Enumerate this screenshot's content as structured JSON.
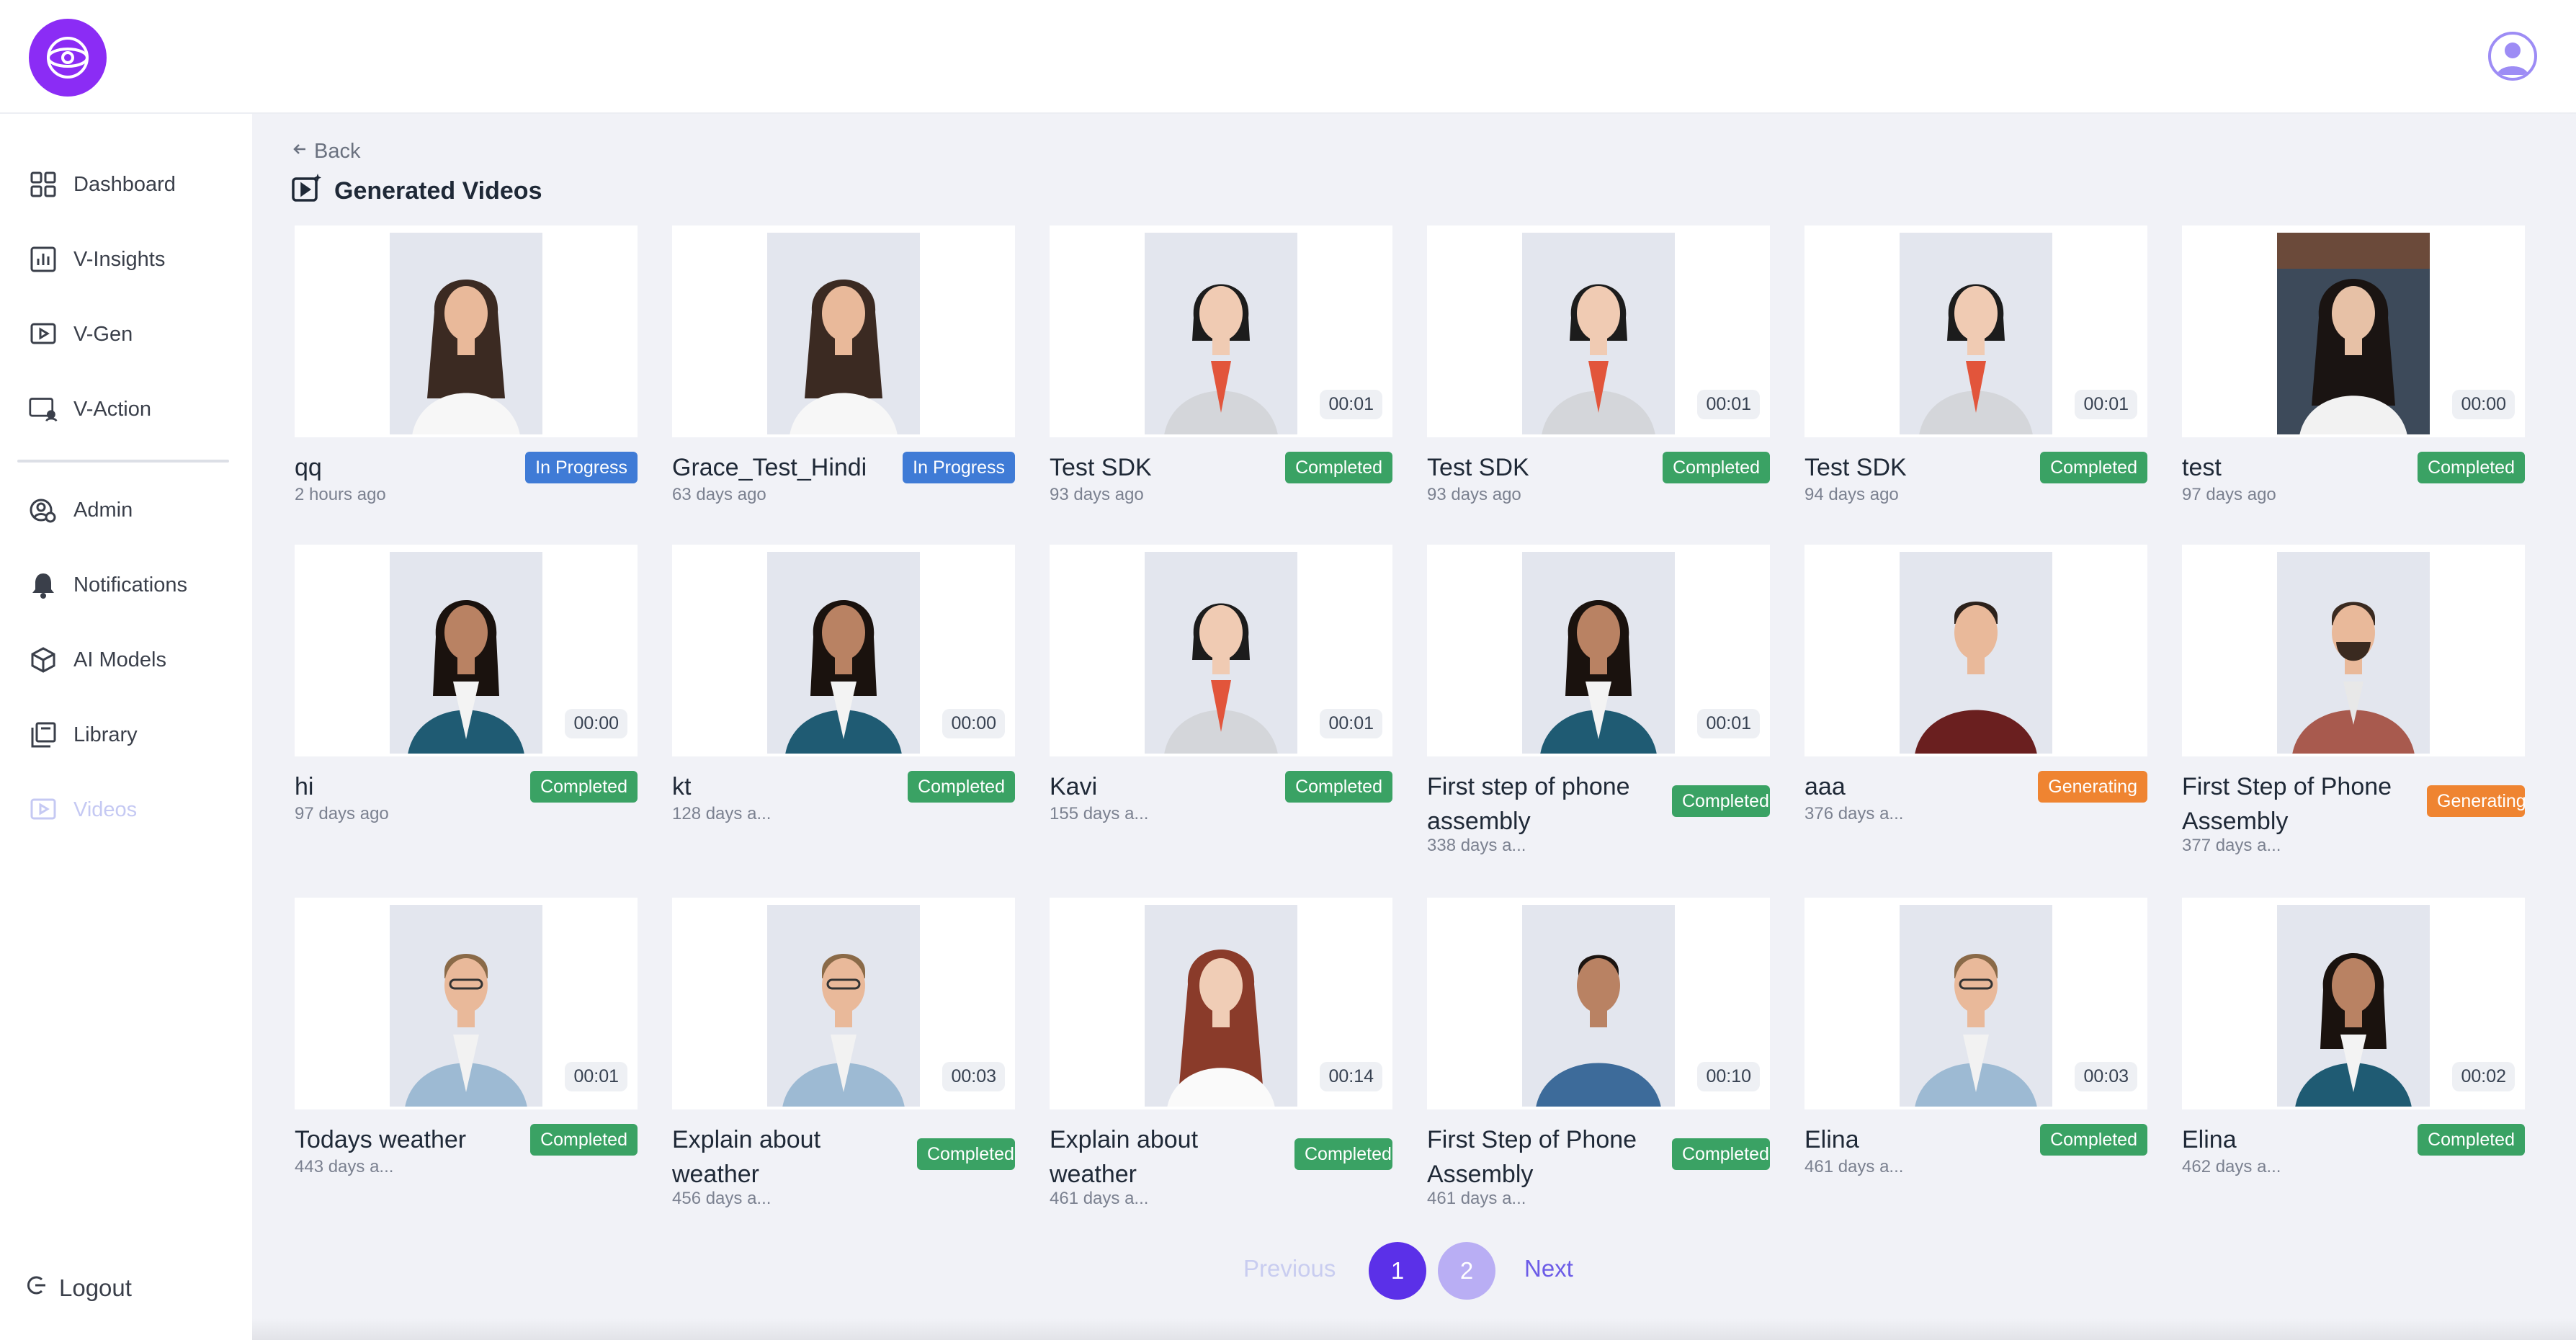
{
  "header": {
    "logo_icon": "globe-eye-logo",
    "profile_icon": "user-avatar-icon",
    "accent": "#8b2cf5"
  },
  "sidebar": {
    "items": [
      {
        "label": "Dashboard",
        "icon": "grid-icon"
      },
      {
        "label": "V-Insights",
        "icon": "bar-chart-icon"
      },
      {
        "label": "V-Gen",
        "icon": "play-square-icon"
      },
      {
        "label": "V-Action",
        "icon": "monitor-user-icon"
      },
      {
        "label": "Admin",
        "icon": "user-gear-icon"
      },
      {
        "label": "Notifications",
        "icon": "bell-icon"
      },
      {
        "label": "AI Models",
        "icon": "cube-icon"
      },
      {
        "label": "Library",
        "icon": "library-icon"
      },
      {
        "label": "Videos",
        "icon": "video-icon"
      }
    ],
    "active": "Videos",
    "logout_label": "Logout"
  },
  "main": {
    "back_label": "Back",
    "title": "Generated Videos",
    "videos": [
      {
        "title": "qq",
        "date": "2 hours ago",
        "status": "In Progress",
        "duration": "",
        "person": "woman-long-hair"
      },
      {
        "title": "Grace_Test_Hindi",
        "date": "63 days ago",
        "status": "In Progress",
        "duration": "",
        "person": "woman-long-hair"
      },
      {
        "title": "Test SDK",
        "date": "93 days ago",
        "status": "Completed",
        "duration": "00:01",
        "person": "woman-bob-blazer"
      },
      {
        "title": "Test SDK",
        "date": "93 days ago",
        "status": "Completed",
        "duration": "00:01",
        "person": "woman-bob-blazer"
      },
      {
        "title": "Test SDK",
        "date": "94 days ago",
        "status": "Completed",
        "duration": "00:01",
        "person": "woman-bob-blazer"
      },
      {
        "title": "test",
        "date": "97 days ago",
        "status": "Completed",
        "duration": "00:00",
        "person": "woman-indoor"
      },
      {
        "title": "hi",
        "date": "97 days ago",
        "status": "Completed",
        "duration": "00:00",
        "person": "woman-teal-blazer"
      },
      {
        "title": "kt",
        "date": "128 days a...",
        "status": "Completed",
        "duration": "00:00",
        "person": "woman-teal-blazer"
      },
      {
        "title": "Kavi",
        "date": "155 days a...",
        "status": "Completed",
        "duration": "00:01",
        "person": "woman-bob-blazer"
      },
      {
        "title": "First step of phone assembly",
        "date": "338 days a...",
        "status": "Completed",
        "duration": "00:01",
        "person": "woman-teal-blazer"
      },
      {
        "title": "aaa",
        "date": "376 days a...",
        "status": "Generating",
        "duration": "",
        "person": "man-sweater"
      },
      {
        "title": "First Step of Phone Assembly",
        "date": "377 days a...",
        "status": "Generating",
        "duration": "",
        "person": "man-plaid"
      },
      {
        "title": "Todays weather",
        "date": "443 days a...",
        "status": "Completed",
        "duration": "00:01",
        "person": "man-denim"
      },
      {
        "title": "Explain about weather",
        "date": "456 days a...",
        "status": "Completed",
        "duration": "00:03",
        "person": "man-denim"
      },
      {
        "title": "Explain about weather",
        "date": "461 days a...",
        "status": "Completed",
        "duration": "00:14",
        "person": "woman-red-hair"
      },
      {
        "title": "First Step of Phone Assembly",
        "date": "461 days a...",
        "status": "Completed",
        "duration": "00:10",
        "person": "man-blue-tee"
      },
      {
        "title": "Elina",
        "date": "461 days a...",
        "status": "Completed",
        "duration": "00:03",
        "person": "man-denim"
      },
      {
        "title": "Elina",
        "date": "462 days a...",
        "status": "Completed",
        "duration": "00:02",
        "person": "woman-teal-blazer"
      }
    ]
  },
  "pagination": {
    "previous_label": "Previous",
    "pages": [
      "1",
      "2"
    ],
    "current": "1",
    "next_label": "Next"
  },
  "colors": {
    "in_progress": "#3f7bd6",
    "completed": "#3aa264",
    "generating": "#ef8431",
    "page_active": "#5b30e8",
    "page_inactive": "#b9aef4"
  }
}
